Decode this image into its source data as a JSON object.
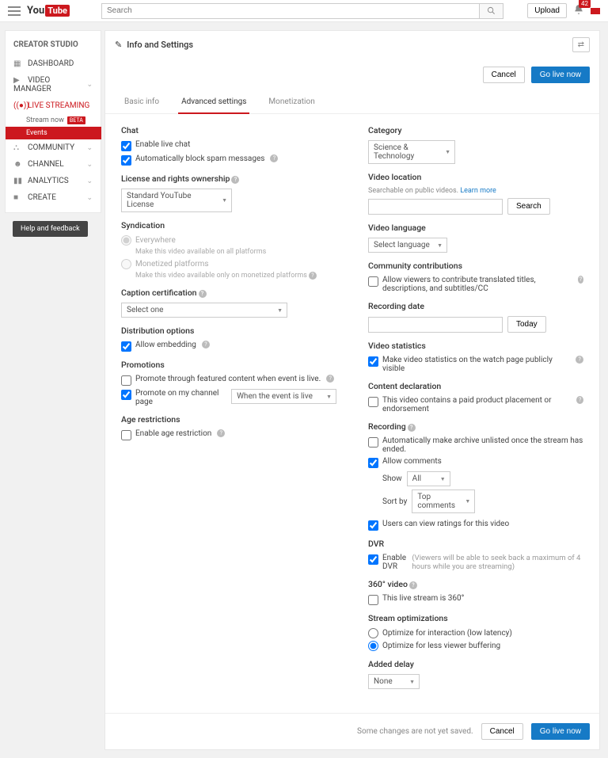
{
  "header": {
    "logo_you": "You",
    "logo_tube": "Tube",
    "search_placeholder": "Search",
    "upload": "Upload",
    "notif_count": "42"
  },
  "sidebar": {
    "title": "CREATOR STUDIO",
    "dashboard": "DASHBOARD",
    "video_manager": "VIDEO MANAGER",
    "live": "LIVE STREAMING",
    "stream_now": "Stream now",
    "beta": "BETA",
    "events": "Events",
    "community": "COMMUNITY",
    "channel": "CHANNEL",
    "analytics": "ANALYTICS",
    "create": "CREATE",
    "help": "Help and feedback"
  },
  "page": {
    "title": "Info and Settings",
    "cancel": "Cancel",
    "go_live": "Go live now",
    "tabs": {
      "basic": "Basic info",
      "advanced": "Advanced settings",
      "monet": "Monetization"
    }
  },
  "left": {
    "chat": "Chat",
    "enable_chat": "Enable live chat",
    "auto_block": "Automatically block spam messages",
    "license_title": "License and rights ownership",
    "license_val": "Standard YouTube License",
    "synd": "Syndication",
    "everywhere": "Everywhere",
    "everywhere_sub": "Make this video available on all platforms",
    "monet_plat": "Monetized platforms",
    "monet_sub": "Make this video available only on monetized platforms",
    "caption_title": "Caption certification",
    "caption_val": "Select one",
    "dist": "Distribution options",
    "embed": "Allow embedding",
    "promo": "Promotions",
    "promo_feat": "Promote through featured content when event is live.",
    "promo_chan": "Promote on my channel page",
    "promo_when": "When the event is live",
    "age": "Age restrictions",
    "age_enable": "Enable age restriction"
  },
  "right": {
    "category": "Category",
    "category_val": "Science & Technology",
    "loc_title": "Video location",
    "loc_hint": "Searchable on public videos.",
    "learn_more": "Learn more",
    "search_btn": "Search",
    "lang_title": "Video language",
    "lang_val": "Select language",
    "cc_title": "Community contributions",
    "cc_allow": "Allow viewers to contribute translated titles, descriptions, and subtitles/CC",
    "rec_date": "Recording date",
    "today": "Today",
    "stats_title": "Video statistics",
    "stats_cb": "Make video statistics on the watch page publicly visible",
    "decl_title": "Content declaration",
    "decl_cb": "This video contains a paid product placement or endorsement",
    "rec_title": "Recording",
    "auto_unlist": "Automatically make archive unlisted once the stream has ended.",
    "allow_comments": "Allow comments",
    "show": "Show",
    "show_val": "All",
    "sort": "Sort by",
    "sort_val": "Top comments",
    "ratings": "Users can view ratings for this video",
    "dvr_title": "DVR",
    "dvr_cb": "Enable DVR",
    "dvr_note": "(Viewers will be able to seek back a maximum of 4 hours while you are streaming)",
    "v360_title": "360° video",
    "v360_cb": "This live stream is 360°",
    "opt_title": "Stream optimizations",
    "opt_low": "Optimize for interaction (low latency)",
    "opt_buf": "Optimize for less viewer buffering",
    "delay_title": "Added delay",
    "delay_val": "None"
  },
  "footer": {
    "unsaved": "Some changes are not yet saved.",
    "cancel": "Cancel",
    "go_live": "Go live now"
  }
}
